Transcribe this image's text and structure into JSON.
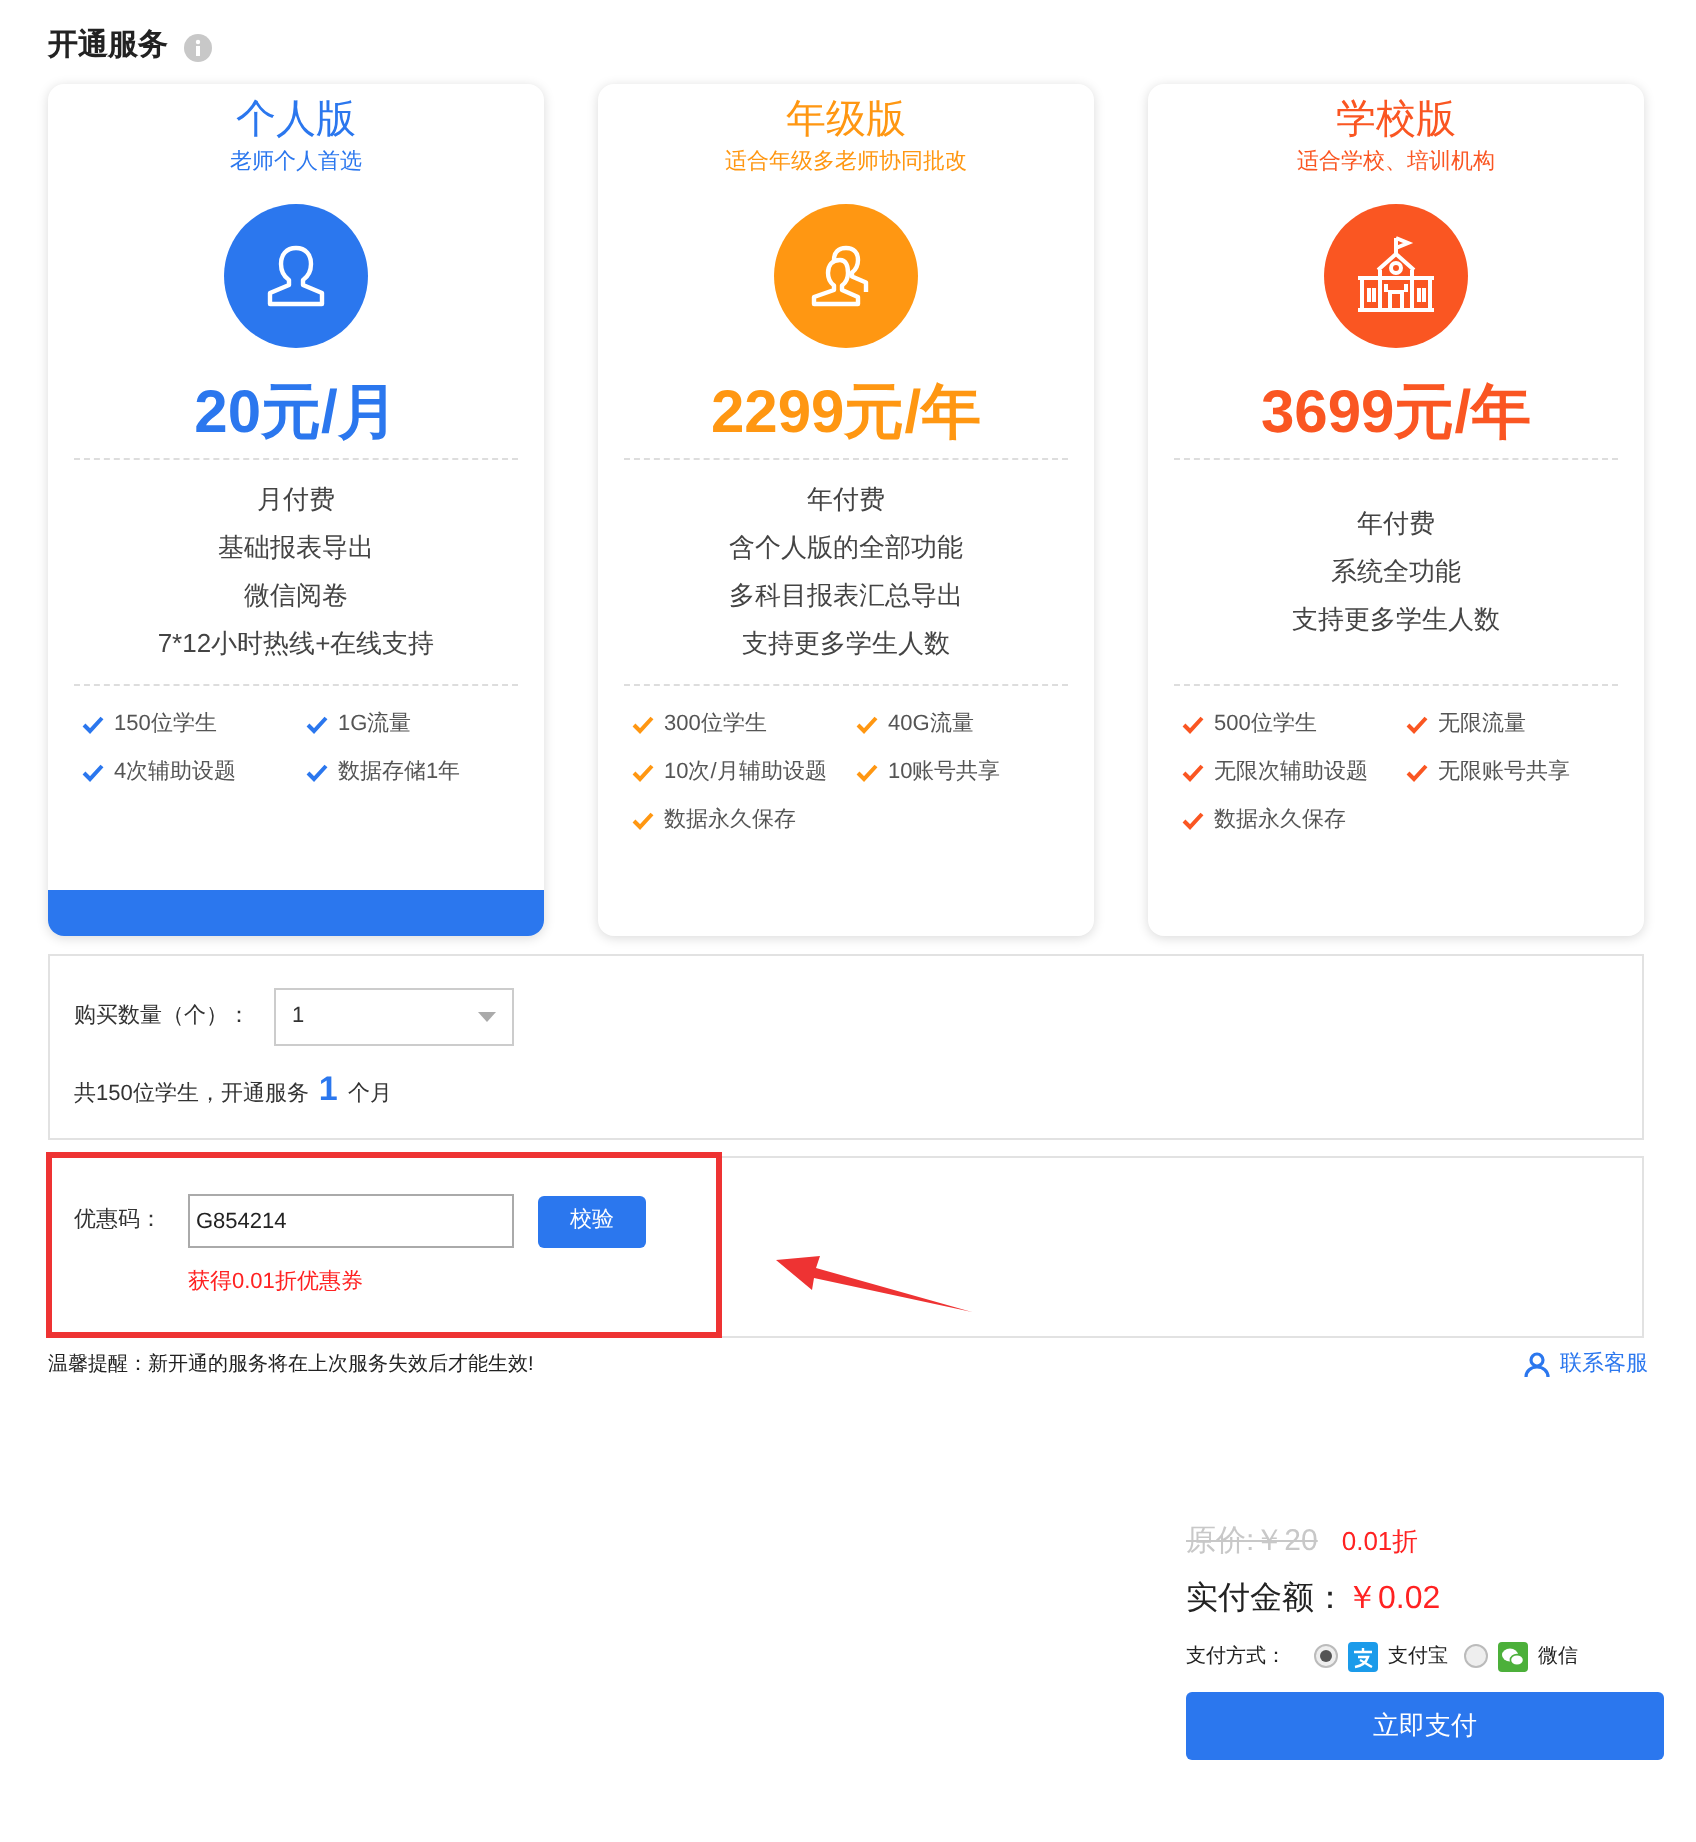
{
  "section": {
    "title": "开通服务"
  },
  "plans": [
    {
      "kind": "person",
      "selected": true,
      "color": "#2b77ee",
      "title": "个人版",
      "subtitle": "老师个人首选",
      "price": "20元/月",
      "features": [
        "月付费",
        "基础报表导出",
        "微信阅卷",
        "7*12小时热线+在线支持"
      ],
      "perks": [
        "150位学生",
        "1G流量",
        "4次辅助设题",
        "数据存储1年"
      ]
    },
    {
      "kind": "group",
      "selected": false,
      "color": "#ff9712",
      "title": "年级版",
      "subtitle": "适合年级多老师协同批改",
      "price": "2299元/年",
      "features": [
        "年付费",
        "含个人版的全部功能",
        "多科目报表汇总导出",
        "支持更多学生人数"
      ],
      "perks": [
        "300位学生",
        "40G流量",
        "10次/月辅助设题",
        "10账号共享",
        "数据永久保存"
      ]
    },
    {
      "kind": "school",
      "selected": false,
      "color": "#fa5622",
      "title": "学校版",
      "subtitle": "适合学校、培训机构",
      "price": "3699元/年",
      "features": [
        "年付费",
        "系统全功能",
        "支持更多学生人数"
      ],
      "perks": [
        "500位学生",
        "无限流量",
        "无限次辅助设题",
        "无限账号共享",
        "数据永久保存"
      ]
    }
  ],
  "quantity": {
    "label": "购买数量（个）：",
    "value": "1",
    "summary_before": "共150位学生，开通服务",
    "summary_months": "1",
    "summary_after": "个月"
  },
  "coupon": {
    "label": "优惠码：",
    "value": "G854214",
    "button": "校验",
    "message": "获得0.01折优惠券"
  },
  "notice": "温馨提醒：新开通的服务将在上次服务失效后才能生效!",
  "support_link": "联系客服",
  "summary": {
    "original_price": "原价:￥20",
    "discount": "0.01折",
    "total_label": "实付金额：",
    "total": "￥0.02",
    "method_label": "支付方式：",
    "methods": [
      {
        "kind": "alipay",
        "label": "支付宝",
        "selected": true
      },
      {
        "kind": "wechat",
        "label": "微信",
        "selected": false
      }
    ],
    "pay_button": "立即支付"
  }
}
